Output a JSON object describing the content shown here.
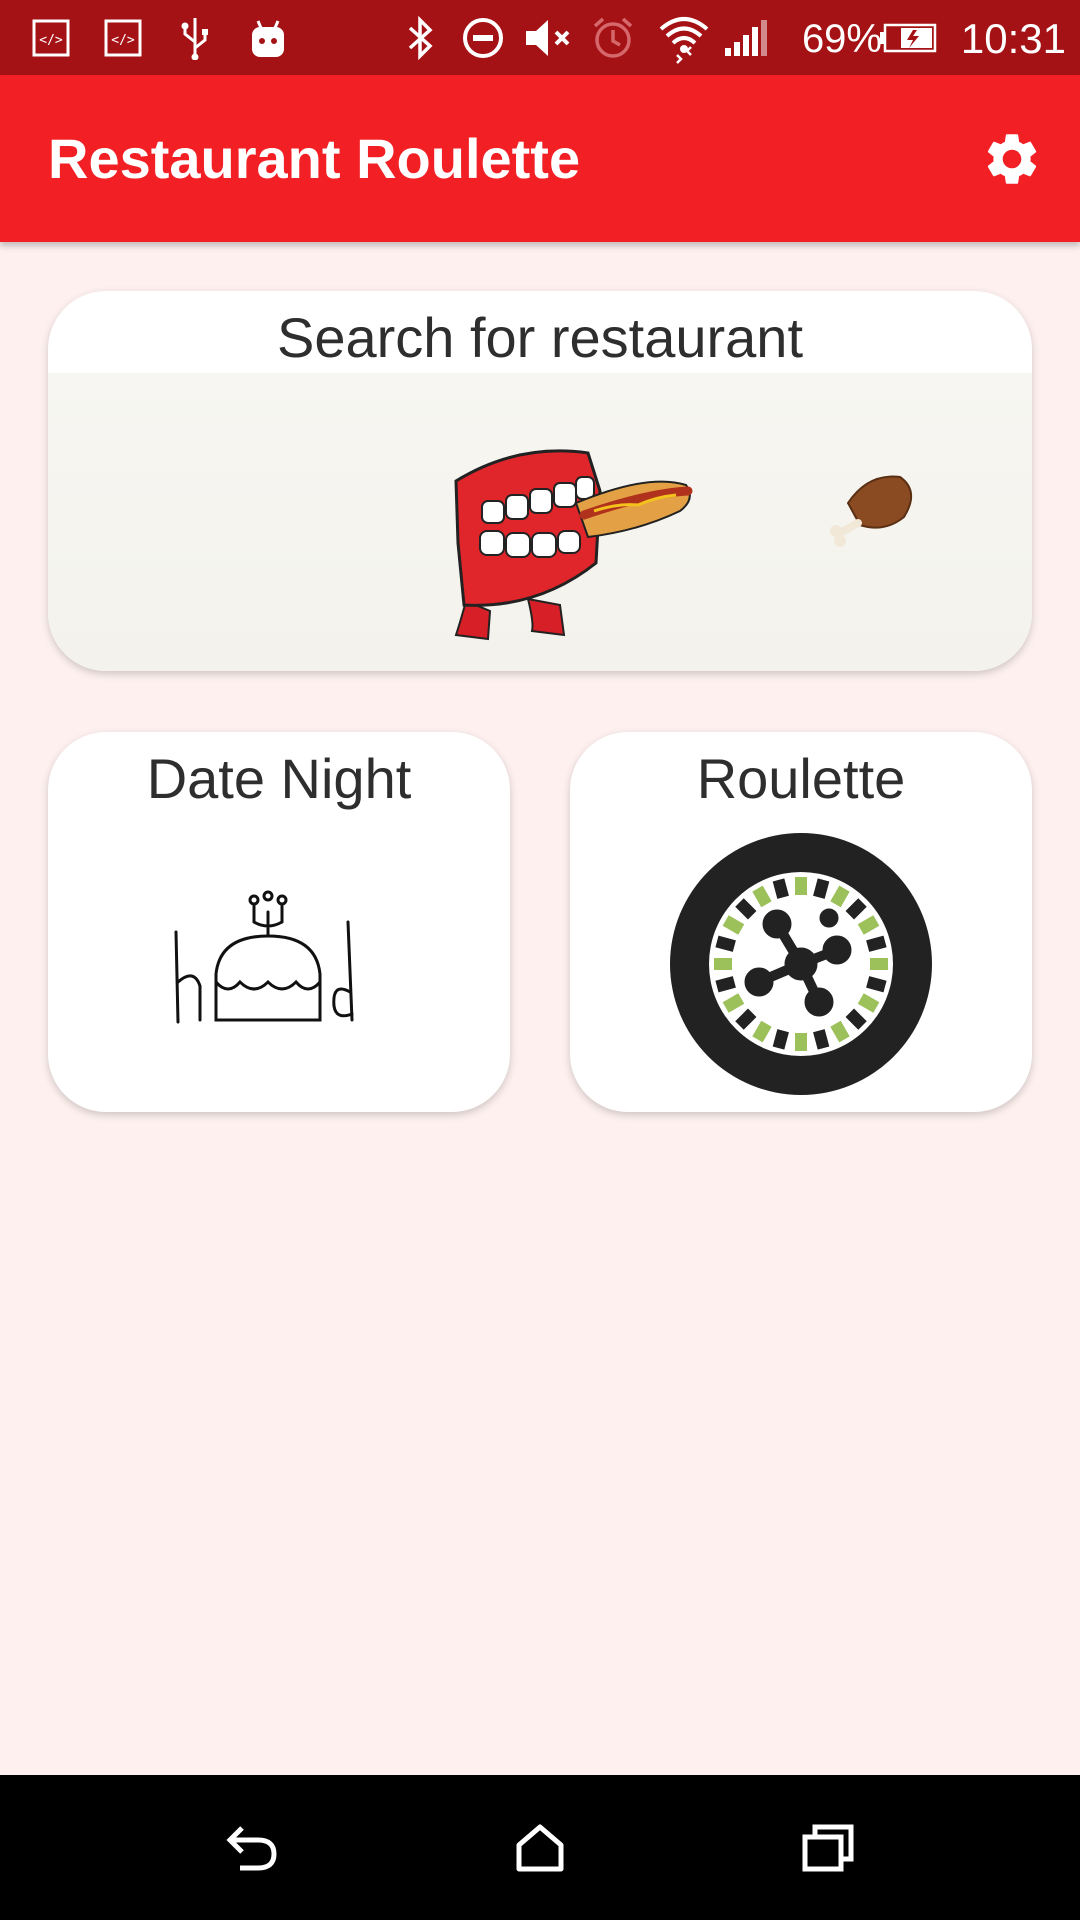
{
  "status_bar": {
    "battery_percent": "69%",
    "time": "10:31",
    "icons": [
      "dev-code-icon",
      "dev-code-icon",
      "usb-icon",
      "android-icon",
      "bluetooth-icon",
      "do-not-disturb-icon",
      "mute-icon",
      "alarm-icon",
      "wifi-icon",
      "signal-icon",
      "battery-charging-icon"
    ]
  },
  "app_bar": {
    "title": "Restaurant Roulette",
    "settings_icon": "gear-icon"
  },
  "cards": {
    "search": {
      "title": "Search for restaurant"
    },
    "date_night": {
      "title": "Date Night"
    },
    "roulette": {
      "title": "Roulette"
    }
  },
  "nav_bar": {
    "icons": [
      "back-icon",
      "home-icon",
      "recents-icon"
    ]
  },
  "colors": {
    "status_bar": "#a51216",
    "app_bar": "#f21f25",
    "background": "#fdf0ef",
    "roulette_green": "#9dc15a"
  }
}
